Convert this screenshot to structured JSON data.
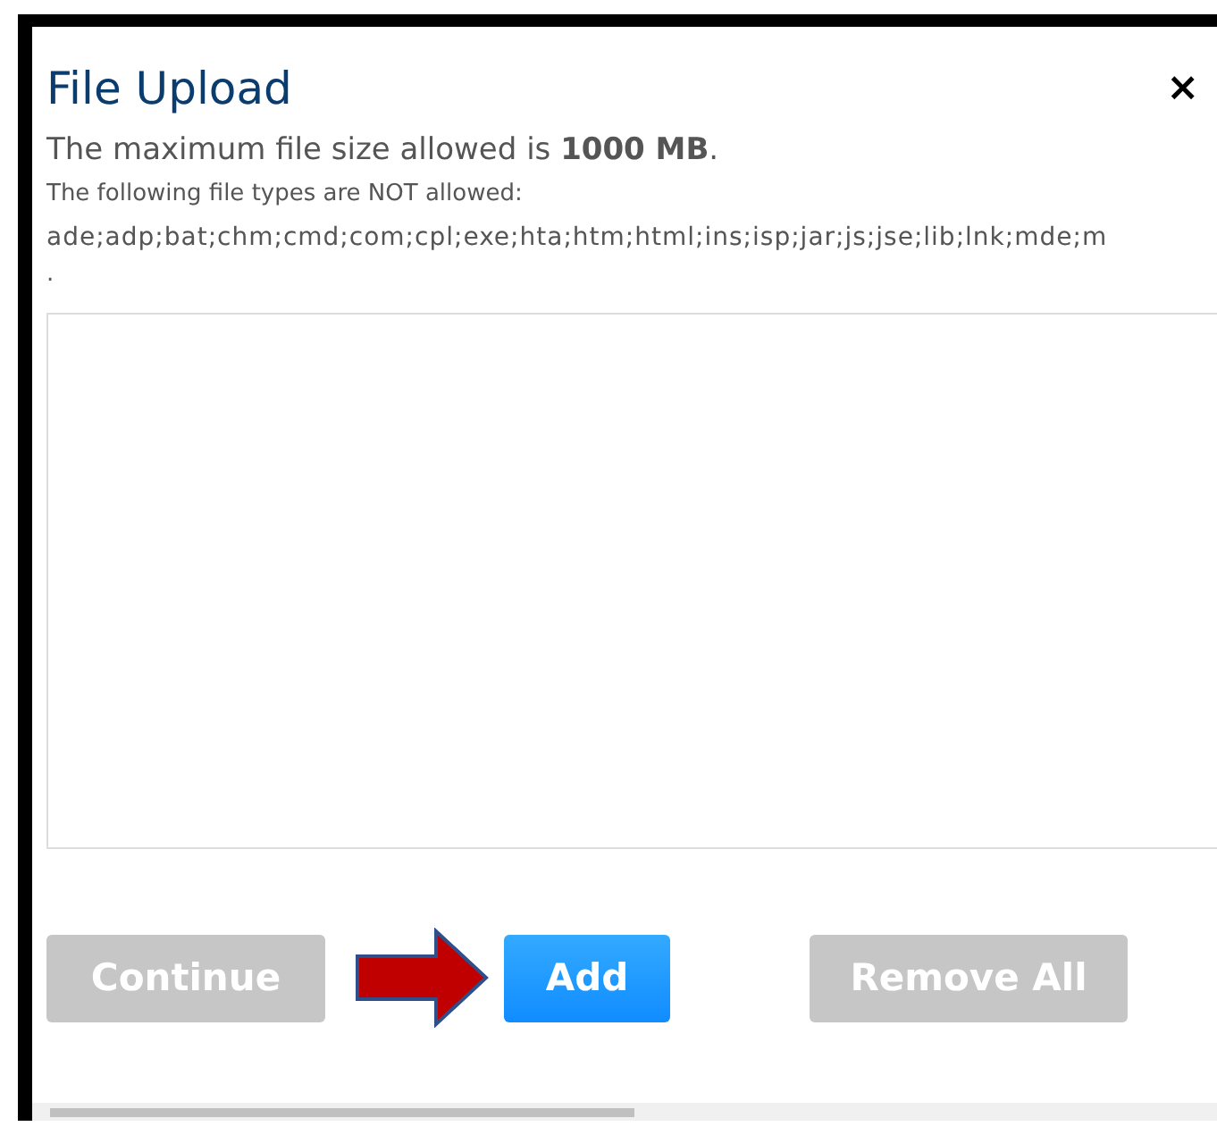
{
  "dialog": {
    "title": "File Upload",
    "close": "×"
  },
  "info": {
    "size_limit": "The maximum file size allowed is **1000 MB**.",
    "types_label": "The following file types are NOT allowed:",
    "types_list": "ade;adp;bat;chm;cmd;com;cpl;exe;hta;htm;html;ins;isp;jar;js;jse;lib;lnk;mde;m",
    "types_end": "."
  },
  "buttons": [
    {
      "label": "Continue",
      "kind": "plain",
      "disabled": true
    },
    {
      "label": "Add",
      "kind": "primary",
      "disabled": false
    },
    {
      "label": "Remove All",
      "kind": "plain",
      "disabled": true
    }
  ]
}
